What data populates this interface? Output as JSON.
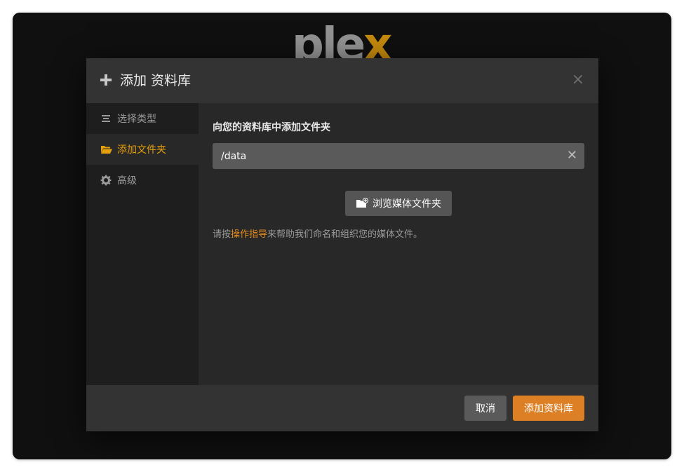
{
  "brand": {
    "logo_main": "ple",
    "logo_x": "x",
    "accent": "#e5a00d"
  },
  "modal": {
    "title": "添加 资料库",
    "close_glyph": "×"
  },
  "sidebar": {
    "items": [
      {
        "label": "选择类型",
        "icon": "list-icon",
        "active": false
      },
      {
        "label": "添加文件夹",
        "icon": "folder-open-icon",
        "active": true
      },
      {
        "label": "高级",
        "icon": "gear-icon",
        "active": false
      }
    ]
  },
  "content": {
    "section_label": "向您的资料库中添加文件夹",
    "path_value": "/data",
    "clear_glyph": "✕",
    "browse_label": "浏览媒体文件夹",
    "hint_prefix": "请按",
    "hint_link": "操作指导",
    "hint_suffix": "来帮助我们命名和组织您的媒体文件。"
  },
  "footer": {
    "cancel_label": "取消",
    "add_label": "添加资料库"
  }
}
